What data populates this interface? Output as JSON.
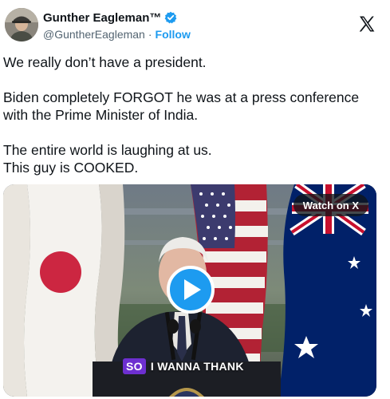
{
  "author": {
    "display_name": "Gunther Eagleman™",
    "handle": "@GuntherEagleman",
    "follow_label": "Follow",
    "verified": true,
    "avatar_icon": "person-in-cap-avatar"
  },
  "platform_icon": "x-logo-icon",
  "tweet": {
    "paragraphs": [
      [
        "We really don’t have a president."
      ],
      [
        "Biden completely FORGOT he was at a press conference",
        "with the Prime Minister of India."
      ],
      [
        "The entire world is laughing at us.",
        "This guy is COOKED."
      ]
    ]
  },
  "media": {
    "watch_label": "Watch on X",
    "caption_highlight": "SO",
    "caption_rest": "I WANNA THANK",
    "play_icon": "play-icon"
  },
  "colors": {
    "accent": "#1d9bf0",
    "caption_highlight": "#6d2fd0",
    "text": "#0f1419",
    "muted": "#536471"
  }
}
